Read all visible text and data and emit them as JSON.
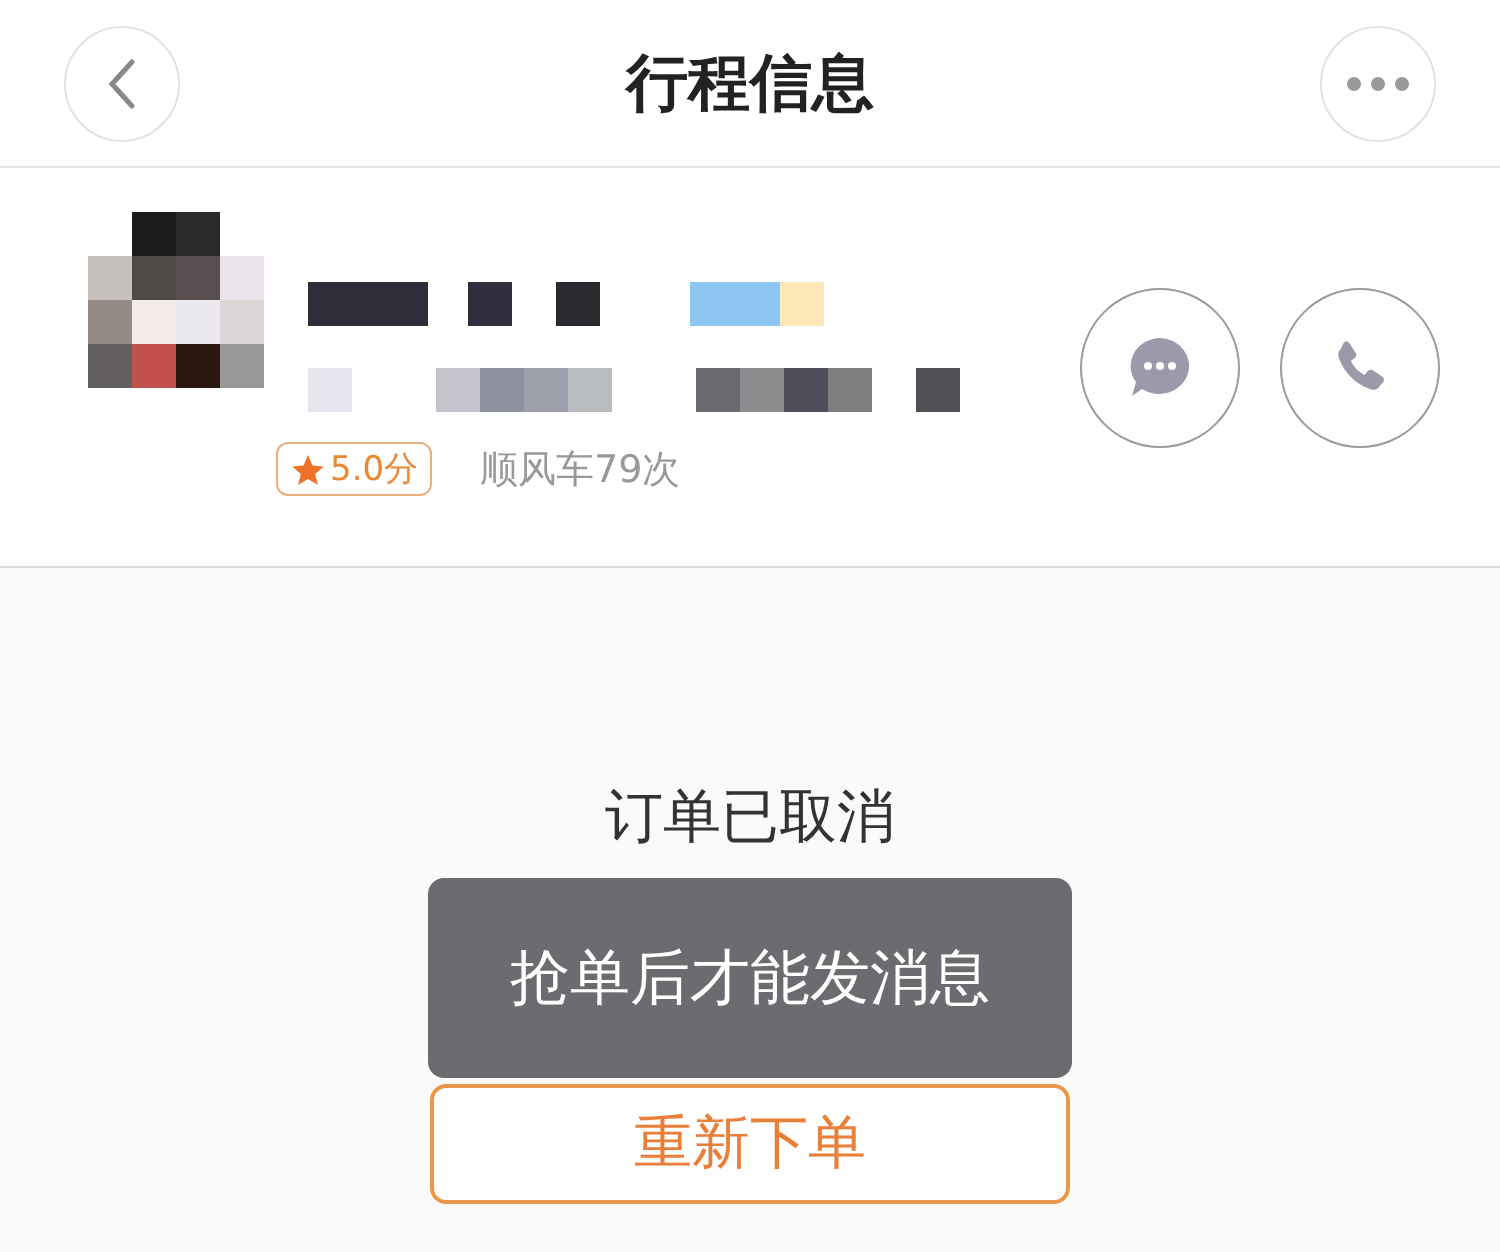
{
  "header": {
    "title": "行程信息"
  },
  "driver": {
    "rating": "5.0分",
    "stars": 1,
    "trips": "顺风车79次"
  },
  "order": {
    "status": "订单已取消",
    "button": "重新下单"
  },
  "toast": {
    "message": "抢单后才能发消息"
  }
}
